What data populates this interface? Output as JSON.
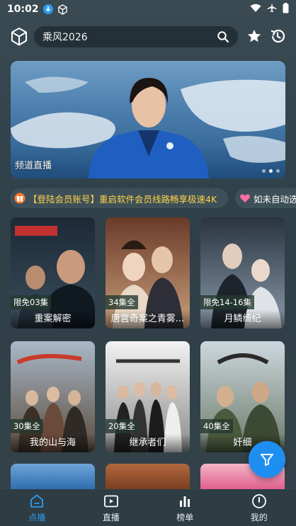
{
  "status_bar": {
    "time": "10:02"
  },
  "search": {
    "query": "乘风2026"
  },
  "banner": {
    "caption": "频道直播",
    "slide_count": 3,
    "active_slide": 2
  },
  "notices": [
    {
      "text": "【登陆会员账号】重启软件会员线路畅享极速4K",
      "icon": "gift-icon"
    },
    {
      "text": "如未自动选",
      "icon": "heart-icon"
    }
  ],
  "shows": [
    {
      "title": "重案解密",
      "badge": "限免03集",
      "colors": [
        "#1c2a36",
        "#3b4d5c"
      ]
    },
    {
      "title": "唐宫奇案之青雾...",
      "badge": "34集全",
      "colors": [
        "#6a3a2a",
        "#c9a07a"
      ]
    },
    {
      "title": "月鳞绮纪",
      "badge": "限免14-16集",
      "colors": [
        "#2a3440",
        "#8a9aab"
      ]
    },
    {
      "title": "我的山与海",
      "badge": "30集全",
      "colors": [
        "#a8b8c8",
        "#5b4b3c"
      ]
    },
    {
      "title": "继承者们",
      "badge": "20集全",
      "colors": [
        "#e8e8e8",
        "#8a8a8a"
      ]
    },
    {
      "title": "奸细",
      "badge": "40集全",
      "colors": [
        "#cdd7de",
        "#6b7a68"
      ]
    }
  ],
  "partial_cards": [
    {
      "colors": [
        "#6fa4d8",
        "#2f6db0"
      ]
    },
    {
      "colors": [
        "#b2673c",
        "#7a3f22"
      ]
    },
    {
      "colors": [
        "#f4b6c8",
        "#e05f8c"
      ]
    }
  ],
  "tabs": [
    {
      "label": "点播",
      "icon": "home-icon",
      "active": true
    },
    {
      "label": "直播",
      "icon": "play-icon",
      "active": false
    },
    {
      "label": "榜单",
      "icon": "chart-icon",
      "active": false
    },
    {
      "label": "我的",
      "icon": "profile-icon",
      "active": false
    }
  ],
  "colors": {
    "accent": "#2d9bf0",
    "fab": "#1f8ef1",
    "notice_text": "#ffd24a"
  }
}
